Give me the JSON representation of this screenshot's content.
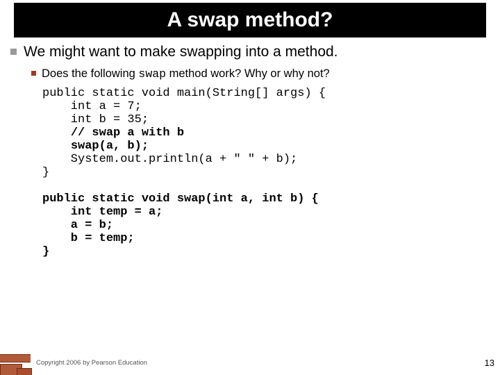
{
  "title": "A swap method?",
  "level1": "We might want to make swapping into a method.",
  "level2_pre": "Does the following ",
  "level2_mono": "swap",
  "level2_post": " method work?  Why or why not?",
  "code": {
    "l1": "public static void main(String[] args) {",
    "l2": "    int a = 7;",
    "l3": "    int b = 35;",
    "l4a": "    ",
    "l4b": "// swap a with b",
    "l5a": "    ",
    "l5b": "swap(a, b);",
    "l6": "    System.out.println(a + \" \" + b);",
    "l7": "}",
    "l8": "",
    "l9a": "public static void swap(int a, int b) {",
    "l10": "    int temp = a;",
    "l11": "    a = b;",
    "l12": "    b = temp;",
    "l13": "}"
  },
  "footer": "Copyright 2006 by Pearson Education",
  "page": "13"
}
